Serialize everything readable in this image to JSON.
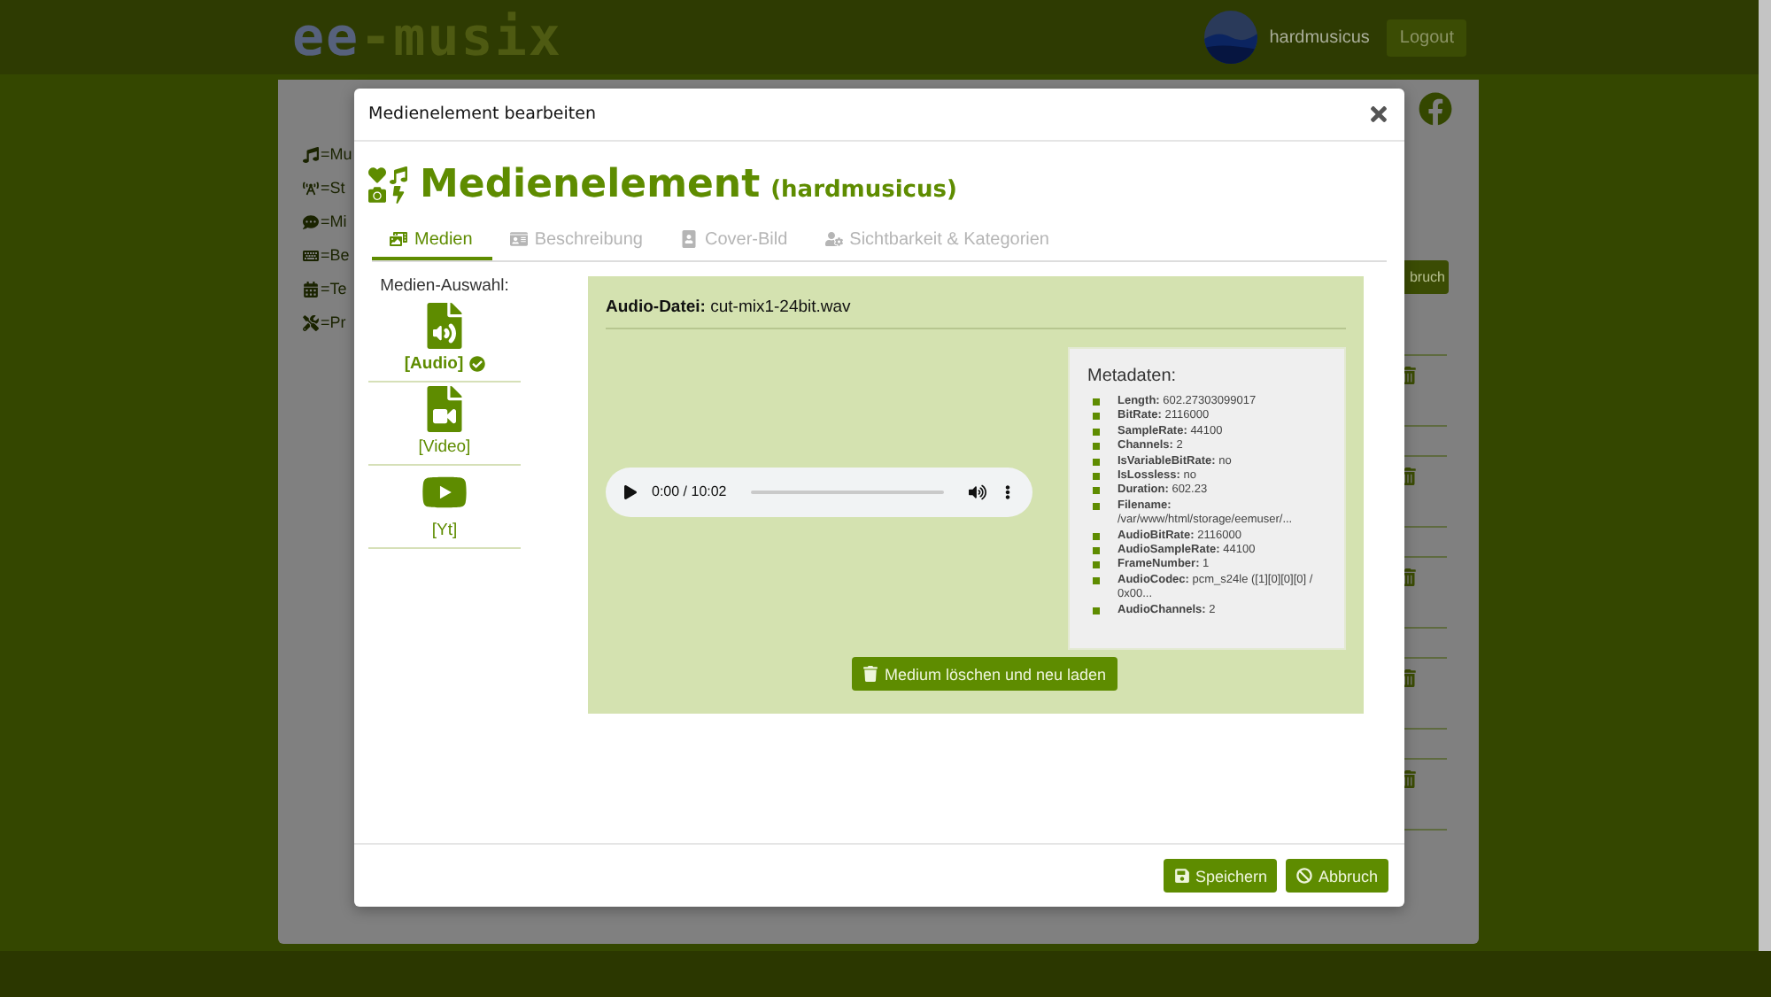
{
  "header": {
    "logo_first": "ee",
    "logo_rest": "-musix",
    "username": "hardmusicus",
    "logout": "Logout"
  },
  "background": {
    "nav_items": [
      {
        "kind": "music",
        "label": "=Mu"
      },
      {
        "kind": "stream",
        "label": "=St"
      },
      {
        "kind": "comment",
        "label": "=Mi"
      },
      {
        "kind": "keyboard",
        "label": "=Be"
      },
      {
        "kind": "calendar",
        "label": "=Te"
      },
      {
        "kind": "tools",
        "label": "=Pr"
      }
    ],
    "cancel_button": "bruch"
  },
  "dialog": {
    "title": "Medienelement bearbeiten",
    "heading": "Medienelement",
    "owner": "(hardmusicus)",
    "tabs": [
      {
        "kind": "media",
        "label": "Medien",
        "selected": true
      },
      {
        "kind": "description",
        "label": "Beschreibung",
        "selected": false
      },
      {
        "kind": "cover",
        "label": "Cover-Bild",
        "selected": false
      },
      {
        "kind": "visibility",
        "label": "Sichtbarkeit & Kategorien",
        "selected": false
      }
    ],
    "media_choice": {
      "label": "Medien-Auswahl:",
      "items": [
        {
          "kind": "audio",
          "label": "[Audio]",
          "selected": true
        },
        {
          "kind": "video",
          "label": "[Video]",
          "selected": false
        },
        {
          "kind": "youtube",
          "label": "[Yt]",
          "selected": false
        }
      ]
    },
    "file": {
      "label": "Audio-Datei:",
      "name": "cut-mix1-24bit.wav"
    },
    "player": {
      "time": "0:00 / 10:02"
    },
    "metadata": {
      "title": "Metadaten:",
      "entries": [
        {
          "key": "Length:",
          "value": "602.27303099017"
        },
        {
          "key": "BitRate:",
          "value": "2116000"
        },
        {
          "key": "SampleRate:",
          "value": "44100"
        },
        {
          "key": "Channels:",
          "value": "2"
        },
        {
          "key": "IsVariableBitRate:",
          "value": "no"
        },
        {
          "key": "IsLossless:",
          "value": "no"
        },
        {
          "key": "Duration:",
          "value": "602.23"
        },
        {
          "key": "Filename:",
          "value": "/var/www/html/storage/eemuser/..."
        },
        {
          "key": "AudioBitRate:",
          "value": "2116000"
        },
        {
          "key": "AudioSampleRate:",
          "value": "44100"
        },
        {
          "key": "FrameNumber:",
          "value": "1"
        },
        {
          "key": "AudioCodec:",
          "value": "pcm_s24le ([1][0][0][0] / 0x00..."
        },
        {
          "key": "AudioChannels:",
          "value": "2"
        }
      ]
    },
    "delete_button": "Medium löschen und neu laden",
    "buttons": [
      {
        "kind": "save",
        "label": "Speichern"
      },
      {
        "kind": "cancel",
        "label": "Abbruch"
      }
    ]
  }
}
